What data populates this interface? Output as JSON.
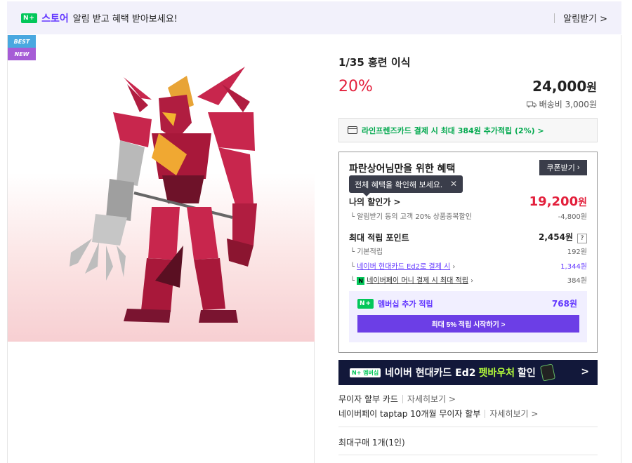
{
  "topbar": {
    "nplus_label": "N+",
    "store_label": "스토어",
    "alarm_message": "알림 받고 혜택 받아보세요!",
    "alarm_button": "알림받기 >"
  },
  "product": {
    "badges": [
      "BEST",
      "NEW"
    ],
    "title": "1/35 홍련 이식",
    "discount": "20%",
    "price": "24,000",
    "price_unit": "원",
    "shipping": "배송비 3,000원"
  },
  "card_promo": "라인프렌즈카드 결제 시 최대 384원 추가적립 (2%) >",
  "benefits": {
    "title": "파란상어님만을 위한 혜택",
    "coupon_button": "쿠폰받기",
    "tooltip": "전체 혜택을 확인해 보세요.",
    "my_discount_label": "나의 할인가 >",
    "my_discount_amount": "19,200",
    "my_discount_unit": "원",
    "my_discount_sub_label": "알림받기 동의 고객 20% 상품중복할인",
    "my_discount_sub_amount": "-4,800원",
    "max_points_label": "최대 적립 포인트",
    "max_points_amount": "2,454원",
    "basic_label": "기본적립",
    "basic_amount": "192원",
    "hyundai_label": "네이버 현대카드 Ed2로 결제 시",
    "hyundai_amount": "1,344원",
    "npay_label": "네이버페이 머니 결제 시 최대 적립",
    "npay_amount": "384원",
    "membership_label": "멤버십 추가 적립",
    "membership_amount": "768원",
    "membership_button": "최대 5% 적립 시작하기 >"
  },
  "banner": {
    "tag": "N+ 멤버십",
    "text_before": "네이버 현대카드 Ed2",
    "text_highlight": "펫바우처",
    "text_after": "할인",
    "arrow": ">"
  },
  "installments": {
    "line1": "무이자 할부 카드",
    "line1_more": "자세히보기 >",
    "line2": "네이버페이 taptap 10개월 무이자 할부",
    "line2_more": "자세히보기 >"
  },
  "max_purchase": "최대구매 1개(1인)",
  "colors": {
    "accent_red": "#e3203c",
    "brand_green": "#03c75a",
    "naver_purple": "#6338ff"
  }
}
